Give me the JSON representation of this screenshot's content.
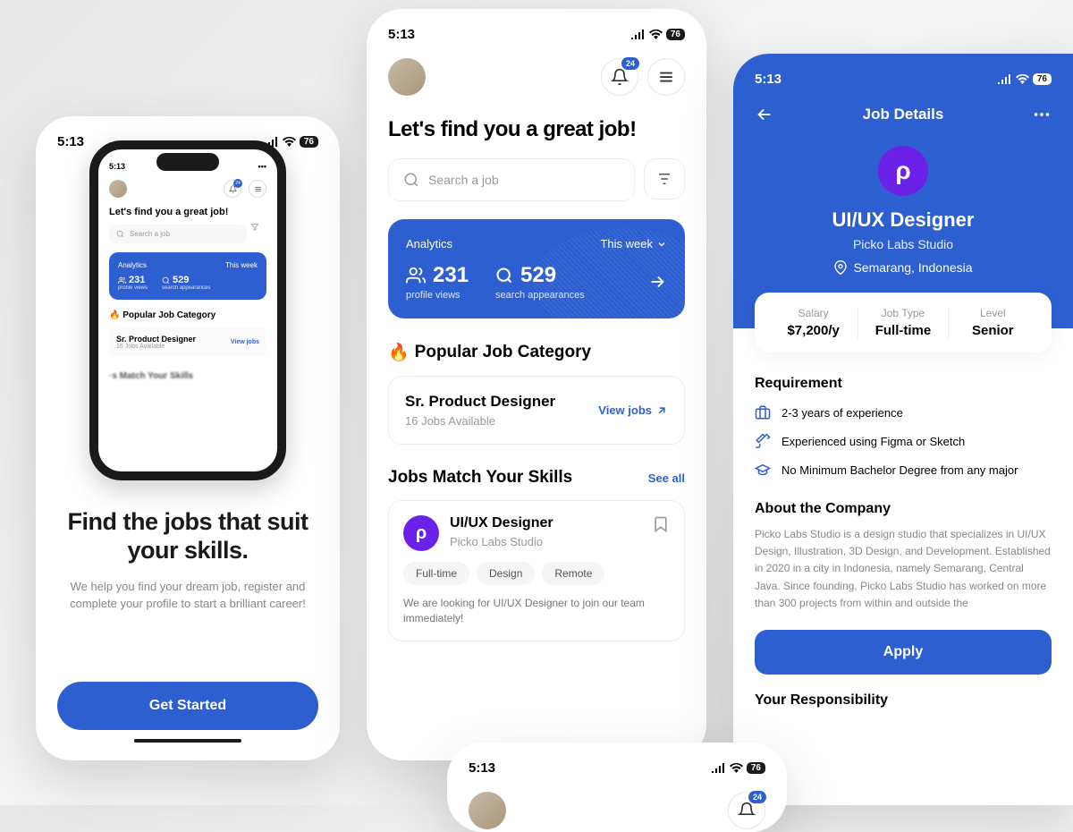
{
  "status": {
    "time": "5:13",
    "battery": "76"
  },
  "onboard": {
    "title": "Find the jobs that suit your skills.",
    "subtitle": "We help you find your dream job, register and complete your profile to start a brilliant career!",
    "cta": "Get Started"
  },
  "home": {
    "notification_count": "24",
    "title": "Let's find you a great job!",
    "search_placeholder": "Search a job",
    "analytics": {
      "label": "Analytics",
      "period": "This week",
      "views": "231",
      "views_label": "profile views",
      "appearances": "529",
      "appearances_label": "search appearances"
    },
    "popular_section": "Popular Job Category",
    "popular_job": {
      "title": "Sr. Product Designer",
      "sub": "16 Jobs Available",
      "cta": "View jobs"
    },
    "match_section": "Jobs Match Your Skills",
    "see_all": "See all",
    "match_job": {
      "title": "UI/UX Designer",
      "company": "Picko Labs Studio",
      "tags": [
        "Full-time",
        "Design",
        "Remote"
      ],
      "desc": "We are looking for UI/UX Designer to join our team immediately!"
    }
  },
  "detail": {
    "nav_title": "Job Details",
    "title": "UI/UX Designer",
    "company": "Picko Labs Studio",
    "location": "Semarang, Indonesia",
    "salary_label": "Salary",
    "salary": "$7,200/y",
    "type_label": "Job Type",
    "type": "Full-time",
    "level_label": "Level",
    "level": "Senior",
    "req_title": "Requirement",
    "reqs": [
      "2-3 years of experience",
      "Experienced using Figma or Sketch",
      "No Minimum Bachelor Degree from any major"
    ],
    "about_title": "About the Company",
    "about": "Picko Labs Studio is a design studio that specializes in UI/UX Design, Illustration, 3D Design, and Development. Established in 2020 in a city in Indonesia, namely Semarang, Central Java. Since founding, Picko Labs Studio has worked on more than 300 projects from within and outside the",
    "apply": "Apply",
    "resp_title": "Your Responsibility"
  }
}
